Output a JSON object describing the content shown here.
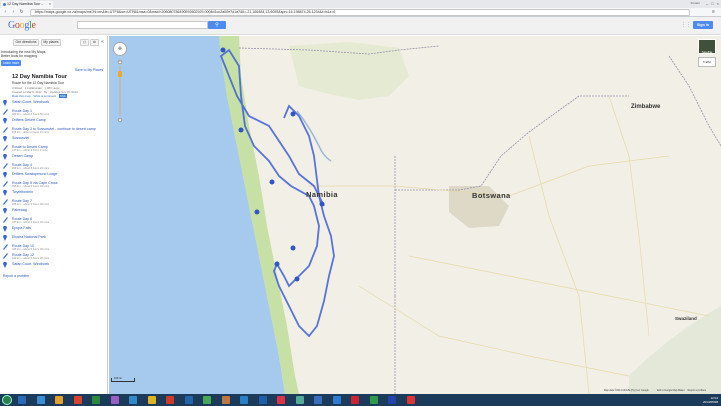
{
  "browser": {
    "tab_title": "12 Day Namibia Tour - ",
    "tab_close": "×",
    "url": "https://maps.google.co.za/maps/ms?hl=en&ie=UTF8&oe=UTF8&msa=0&msid=206080786490592602929.0004d1cc2a00e7d1a7&ll=-21.166484,13.6055&spn=16.198874,26.1234&t=h&z=6",
    "window_controls": [
      "–",
      "□",
      "×"
    ],
    "account_label": "Kirsten"
  },
  "header": {
    "logo": [
      "G",
      "o",
      "o",
      "g",
      "l",
      "e"
    ],
    "search_value": "",
    "search_icon": "magnifier-icon",
    "signin_label": "Sign in"
  },
  "panel": {
    "get_directions": "Get directions",
    "my_places": "My places",
    "promo_line1": "Introducing the new My Maps.",
    "promo_line2": "Better tools for mapping.",
    "learn_more": "Learn more",
    "save_link": "Save to My Places",
    "title": "12 Day Namibia Tour",
    "subtitle": "Route for the 12 Day Namibia Tour",
    "meta1": "Unlisted · 1 Collaborator · 1,963 views",
    "meta2": "Created on Mar 6, 2012 · By · Updated Nov 15, 2012",
    "meta_links": [
      "Rate this map",
      "Write a comment",
      "KML"
    ],
    "items": [
      {
        "title": "Safari Court, Windhoek",
        "sub": "",
        "icon": "placemark-icon"
      },
      {
        "title": "Route Day 1",
        "sub": "380 km – about 4 hours 52 mins",
        "icon": "line-icon"
      },
      {
        "title": "Drifters Desert Camp",
        "sub": "",
        "icon": "placemark-icon"
      },
      {
        "title": "Route Day 3 to Sossusvlei - continue to desert camp",
        "sub": "118 km – about 2 hours 16 mins",
        "icon": "line-icon"
      },
      {
        "title": "Sossusvlei",
        "sub": "",
        "icon": "placemark-icon"
      },
      {
        "title": "Route to Desert Camp",
        "sub": "127 km – about 2 hours 3 mins",
        "icon": "line-icon"
      },
      {
        "title": "Desert Camp",
        "sub": "",
        "icon": "placemark-icon"
      },
      {
        "title": "Route Day 4",
        "sub": "299 km – about 4 hours 24 mins",
        "icon": "line-icon"
      },
      {
        "title": "Drifters Swakopmund Lodge",
        "sub": "",
        "icon": "placemark-icon"
      },
      {
        "title": "Route Day 5 via Cape Cross",
        "sub": "395 km – about 5 hours 34 mins",
        "icon": "line-icon"
      },
      {
        "title": "Twyfelfontein",
        "sub": "",
        "icon": "placemark-icon"
      },
      {
        "title": "Route Day 7",
        "sub": "165 km – about 2 hours 49 mins",
        "icon": "line-icon"
      },
      {
        "title": "Palmwag",
        "sub": "",
        "icon": "placemark-icon"
      },
      {
        "title": "Route Day 8",
        "sub": "347 km – about 4 hours 15 mins",
        "icon": "line-icon"
      },
      {
        "title": "Epupa Falls",
        "sub": "",
        "icon": "placemark-icon"
      },
      {
        "title": "Etosha National Park",
        "sub": "",
        "icon": "placemark-icon"
      },
      {
        "title": "Route Day 10",
        "sub": "425 km – about 5 hours 46 mins",
        "icon": "line-icon"
      },
      {
        "title": "Route Day 12",
        "sub": "429 km – about 5 hours 20 mins",
        "icon": "line-icon"
      },
      {
        "title": "Safari Court, Windhoek",
        "sub": "",
        "icon": "placemark-icon"
      }
    ],
    "report": "Report a problem"
  },
  "map": {
    "labels": {
      "namibia": "Namibia",
      "botswana": "Botswana",
      "zimbabwe": "Zimbabwe",
      "swaziland": "Swaziland"
    },
    "pan_icon": "pan-icon",
    "zoom_in": "+",
    "zoom_out": "−",
    "layer_satellite": "Satellite",
    "layer_traffic": "Traffic",
    "scale": "100 mi",
    "copyright": "Map data ©2014 AfriGIS (Pty) Ltd, Google",
    "footer_links": [
      "Edit in Google Map Maker",
      "Report a problem"
    ]
  },
  "taskbar": {
    "time": "12:04",
    "date": "2014/05/08",
    "icon_colors": [
      "#2b6cb8",
      "#3c8dd1",
      "#e5a02a",
      "#d8432f",
      "#2c8a3c",
      "#9a5fc2",
      "#3388cc",
      "#e0b323",
      "#cc3a2a",
      "#2266aa",
      "#44aa55",
      "#b74",
      "#2a7fc6",
      "#1d5fa8",
      "#d34",
      "#5a9",
      "#3a6fc0",
      "#2f7bd0",
      "#c23",
      "#2e9b4a",
      "#24a",
      "#d33"
    ]
  },
  "colors": {
    "route": "#3b5ed8",
    "sea": "#a6c9ee",
    "land": "#f1efe6",
    "coast_green": "#c7e0a6"
  }
}
